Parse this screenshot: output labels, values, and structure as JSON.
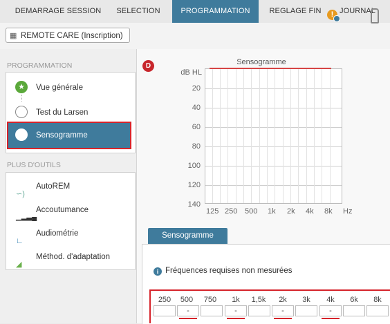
{
  "nav": {
    "tabs": [
      {
        "label": "DEMARRAGE SESSION"
      },
      {
        "label": "SELECTION"
      },
      {
        "label": "PROGRAMMATION",
        "active": true
      },
      {
        "label": "REGLAGE FIN"
      },
      {
        "label": "JOURNAL"
      }
    ]
  },
  "toolbar": {
    "remote_care_label": "REMOTE CARE (Inscription)",
    "icons": [
      "remote-care-icon",
      "warning-icon",
      "hearing-aid-icon"
    ]
  },
  "sidebar": {
    "programmation_title": "PROGRAMMATION",
    "program_items": [
      {
        "label": "Vue générale",
        "icon": "star-check-icon",
        "state": "done"
      },
      {
        "label": "Test du Larsen",
        "icon": "circle-icon",
        "state": "pending"
      },
      {
        "label": "Sensogramme",
        "icon": "circle-icon",
        "state": "selected"
      }
    ],
    "tools_title": "PLUS D'OUTILS",
    "tool_items": [
      {
        "label": "AutoREM",
        "icon": "ear-icon"
      },
      {
        "label": "Accoutumance",
        "icon": "signal-bars-icon"
      },
      {
        "label": "Audiométrie",
        "icon": "audiogram-icon"
      },
      {
        "label": "Méthod. d'adaptation",
        "icon": "fitting-icon"
      }
    ]
  },
  "chart_data": {
    "type": "line",
    "side_badge": "D",
    "title": "Sensogramme",
    "ylabel": "dB HL",
    "xlabel": "Hz",
    "y_ticks": [
      "20",
      "40",
      "60",
      "80",
      "100",
      "120",
      "140"
    ],
    "x_ticks": [
      "125",
      "250",
      "500",
      "1k",
      "2k",
      "4k",
      "8k"
    ],
    "ylim": [
      0,
      140
    ],
    "y_inverted": true,
    "grid": true,
    "series": [
      {
        "x": [
          "125",
          "8k"
        ],
        "y": [
          0,
          0
        ],
        "color": "#d64545"
      }
    ]
  },
  "lower": {
    "tab_label": "Sensogramme",
    "info_text": "Fréquences requises non mesurées",
    "frequencies": [
      {
        "label": "250",
        "value": "",
        "required": false
      },
      {
        "label": "500",
        "value": "-",
        "required": true
      },
      {
        "label": "750",
        "value": "",
        "required": false
      },
      {
        "label": "1k",
        "value": "-",
        "required": true
      },
      {
        "label": "1,5k",
        "value": "",
        "required": false
      },
      {
        "label": "2k",
        "value": "-",
        "required": true
      },
      {
        "label": "3k",
        "value": "",
        "required": false
      },
      {
        "label": "4k",
        "value": "-",
        "required": true
      },
      {
        "label": "6k",
        "value": "",
        "required": false
      },
      {
        "label": "8k",
        "value": "",
        "required": false
      }
    ]
  },
  "colors": {
    "accent": "#3f7b9c",
    "highlight_red": "#d6232a",
    "warning": "#e79a1f"
  }
}
